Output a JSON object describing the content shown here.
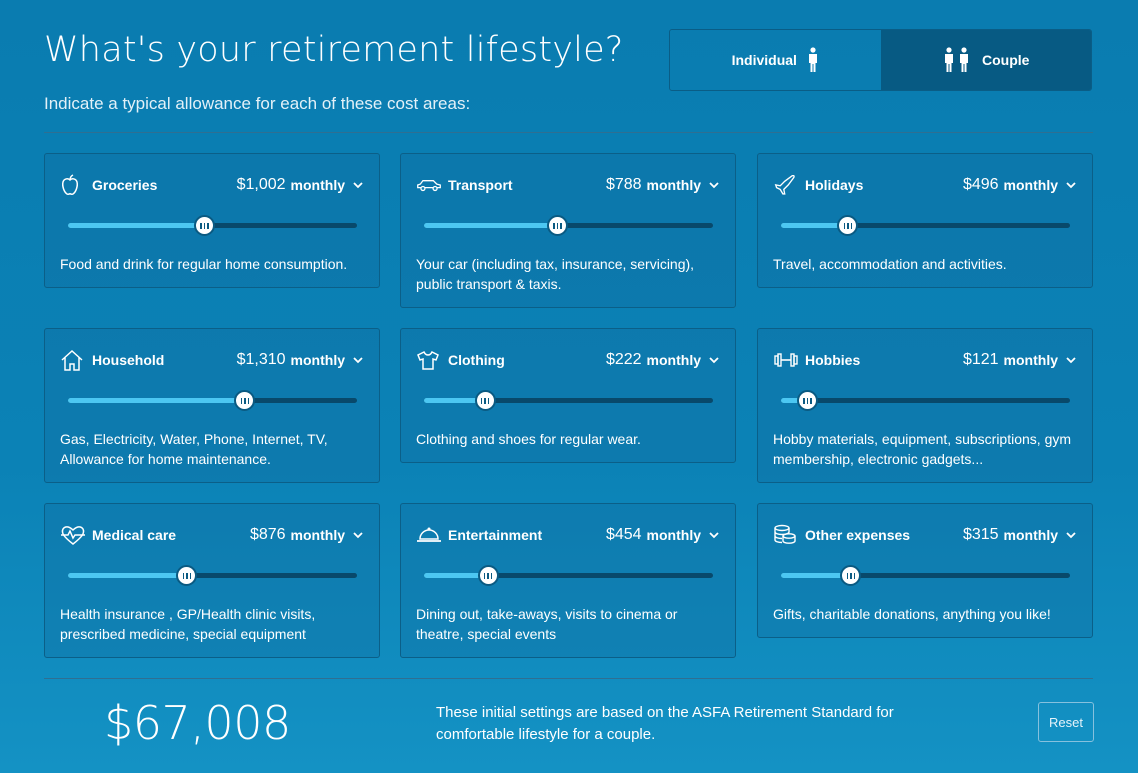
{
  "header": {
    "title": "What's your retirement lifestyle?",
    "subtitle": "Indicate a typical allowance for each of these cost areas:"
  },
  "mode_toggle": {
    "options": [
      {
        "label": "Individual",
        "icon": "person-icon",
        "selected": false
      },
      {
        "label": "Couple",
        "icon": "couple-icon",
        "selected": true
      }
    ]
  },
  "unit_label": "monthly",
  "categories": [
    {
      "name": "Groceries",
      "icon": "apple-icon",
      "amount": "$1,002",
      "level": 0.47,
      "description": "Food and drink for regular home consumption."
    },
    {
      "name": "Transport",
      "icon": "car-icon",
      "amount": "$788",
      "level": 0.46,
      "description": "Your car (including tax, insurance, servicing), public transport & taxis."
    },
    {
      "name": "Holidays",
      "icon": "plane-icon",
      "amount": "$496",
      "level": 0.23,
      "description": "Travel, accommodation and activities."
    },
    {
      "name": "Household",
      "icon": "house-icon",
      "amount": "$1,310",
      "level": 0.61,
      "description": "Gas, Electricity, Water, Phone, Internet, TV, Allowance for home maintenance."
    },
    {
      "name": "Clothing",
      "icon": "tshirt-icon",
      "amount": "$222",
      "level": 0.21,
      "description": "Clothing and shoes for regular wear."
    },
    {
      "name": "Hobbies",
      "icon": "dumbbell-icon",
      "amount": "$121",
      "level": 0.09,
      "description": "Hobby materials, equipment, subscriptions, gym membership, electronic gadgets..."
    },
    {
      "name": "Medical care",
      "icon": "heartbeat-icon",
      "amount": "$876",
      "level": 0.41,
      "description": "Health insurance , GP/Health clinic visits, prescribed medicine, special equipment"
    },
    {
      "name": "Entertainment",
      "icon": "cloche-icon",
      "amount": "$454",
      "level": 0.22,
      "description": "Dining out, take-aways, visits to cinema or theatre, special events"
    },
    {
      "name": "Other expenses",
      "icon": "coins-icon",
      "amount": "$315",
      "level": 0.24,
      "description": "Gifts, charitable donations, anything you like!"
    }
  ],
  "footer": {
    "total": "$67,008",
    "note": "These initial settings are based on the ASFA Retirement Standard for comfortable lifestyle for a couple.",
    "reset_label": "Reset"
  },
  "colors": {
    "background": "#0b82b6",
    "slider_fill": "#4cc7f2",
    "slider_track": "#08496b",
    "active_toggle": "#075a83"
  }
}
